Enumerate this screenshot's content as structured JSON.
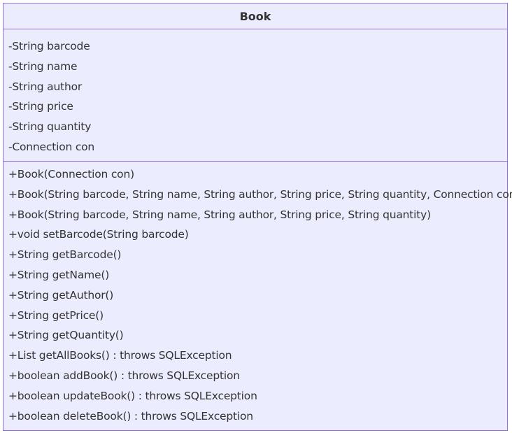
{
  "class_diagram": {
    "class_name": "Book",
    "attributes": [
      "-String barcode",
      "-String name",
      "-String author",
      "-String price",
      "-String quantity",
      "-Connection con"
    ],
    "methods": [
      "+Book(Connection con)",
      "+Book(String barcode, String name, String author, String price, String quantity, Connection con)",
      "+Book(String barcode, String name, String author, String price, String quantity)",
      "+void setBarcode(String barcode)",
      "+String getBarcode()",
      "+String getName()",
      "+String getAuthor()",
      "+String getPrice()",
      "+String getQuantity()",
      "+List getAllBooks() : throws SQLException",
      "+boolean addBook() : throws SQLException",
      "+boolean updateBook() : throws SQLException",
      "+boolean deleteBook() : throws SQLException"
    ],
    "colors": {
      "fill": "#ECECFF",
      "border": "#9370DB",
      "text": "#333333"
    }
  }
}
